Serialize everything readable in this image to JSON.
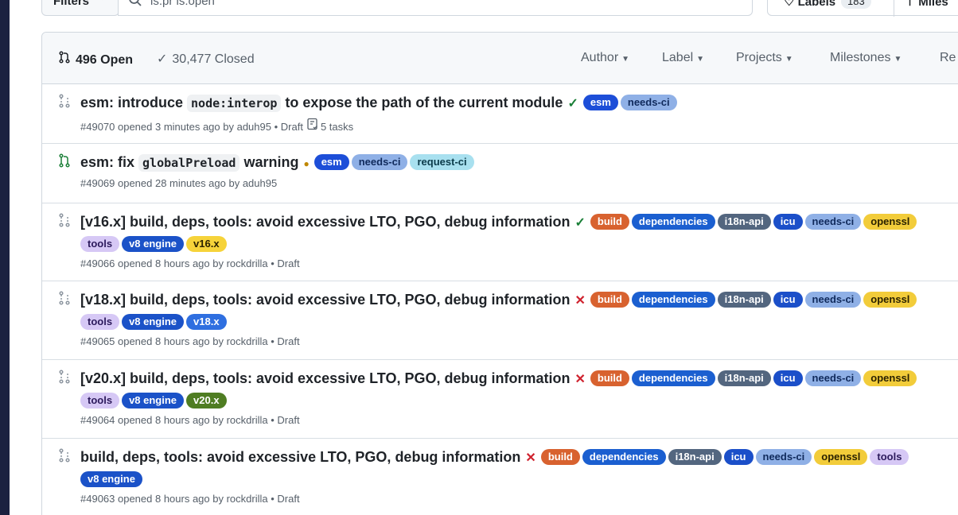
{
  "topbar": {
    "filters_label": "Filters",
    "search_value": "is:pr is:open",
    "labels_label": "Labels",
    "labels_count": "183",
    "milestones_label": "Miles"
  },
  "header": {
    "open_label": "496 Open",
    "closed_label": "30,477 Closed",
    "menus": [
      "Author",
      "Label",
      "Projects",
      "Milestones",
      "Re"
    ]
  },
  "colors": {
    "open": "#1a7f37",
    "fail": "#cf222e",
    "pending": "#bf8700"
  },
  "label_styles": {
    "esm": {
      "bg": "#1d4ed8",
      "fg": "#ffffff"
    },
    "needs-ci": {
      "bg": "#8fb0e6",
      "fg": "#102a5c"
    },
    "request-ci": {
      "bg": "#a8e0ef",
      "fg": "#0b3b4a"
    },
    "build": {
      "bg": "#d8622f",
      "fg": "#ffffff"
    },
    "dependencies": {
      "bg": "#1b5fd0",
      "fg": "#ffffff"
    },
    "i18n-api": {
      "bg": "#53667f",
      "fg": "#ffffff"
    },
    "icu": {
      "bg": "#1b4fc9",
      "fg": "#ffffff"
    },
    "openssl": {
      "bg": "#f2cc3a",
      "fg": "#2b2200"
    },
    "tools": {
      "bg": "#d6c8f5",
      "fg": "#2c1a5c"
    },
    "v8 engine": {
      "bg": "#1b52c8",
      "fg": "#ffffff"
    },
    "v16.x": {
      "bg": "#f6d33a",
      "fg": "#2b2200"
    },
    "v18.x": {
      "bg": "#2f6fe0",
      "fg": "#ffffff"
    },
    "v20.x": {
      "bg": "#4f7d22",
      "fg": "#ffffff"
    }
  },
  "prs": [
    {
      "state": "draft",
      "status": "ok",
      "title_parts": [
        {
          "t": "esm: introduce "
        },
        {
          "c": "node:interop"
        },
        {
          "t": " to expose the path of the current module"
        }
      ],
      "labels": [
        "esm",
        "needs-ci"
      ],
      "meta": "#49070 opened 3 minutes ago by aduh95 • Draft",
      "tasks": "5 tasks"
    },
    {
      "state": "open",
      "status": "pending",
      "title_parts": [
        {
          "t": "esm: fix "
        },
        {
          "c": "globalPreload"
        },
        {
          "t": " warning"
        }
      ],
      "labels": [
        "esm",
        "needs-ci",
        "request-ci"
      ],
      "meta": "#49069 opened 28 minutes ago by aduh95",
      "tasks": ""
    },
    {
      "state": "draft",
      "status": "ok",
      "title_parts": [
        {
          "t": "[v16.x] build, deps, tools: avoid excessive LTO, PGO, debug information"
        }
      ],
      "labels": [
        "build",
        "dependencies",
        "i18n-api",
        "icu",
        "needs-ci",
        "openssl",
        "tools",
        "v8 engine",
        "v16.x"
      ],
      "meta": "#49066 opened 8 hours ago by rockdrilla • Draft",
      "tasks": ""
    },
    {
      "state": "draft",
      "status": "fail",
      "title_parts": [
        {
          "t": "[v18.x] build, deps, tools: avoid excessive LTO, PGO, debug information"
        }
      ],
      "labels": [
        "build",
        "dependencies",
        "i18n-api",
        "icu",
        "needs-ci",
        "openssl",
        "tools",
        "v8 engine",
        "v18.x"
      ],
      "meta": "#49065 opened 8 hours ago by rockdrilla • Draft",
      "tasks": ""
    },
    {
      "state": "draft",
      "status": "fail",
      "title_parts": [
        {
          "t": "[v20.x] build, deps, tools: avoid excessive LTO, PGO, debug information"
        }
      ],
      "labels": [
        "build",
        "dependencies",
        "i18n-api",
        "icu",
        "needs-ci",
        "openssl",
        "tools",
        "v8 engine",
        "v20.x"
      ],
      "meta": "#49064 opened 8 hours ago by rockdrilla • Draft",
      "tasks": ""
    },
    {
      "state": "draft",
      "status": "fail",
      "title_parts": [
        {
          "t": "build, deps, tools: avoid excessive LTO, PGO, debug information"
        }
      ],
      "labels": [
        "build",
        "dependencies",
        "i18n-api",
        "icu",
        "needs-ci",
        "openssl",
        "tools",
        "v8 engine"
      ],
      "meta": "#49063 opened 8 hours ago by rockdrilla • Draft",
      "tasks": ""
    }
  ]
}
